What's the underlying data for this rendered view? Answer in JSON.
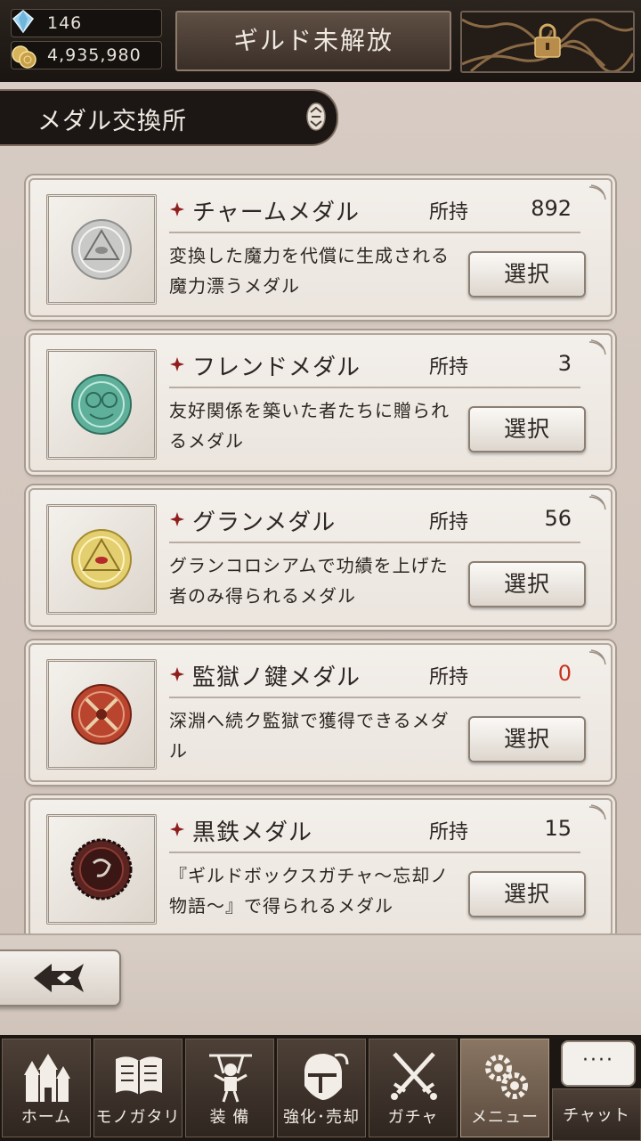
{
  "header": {
    "gems": "146",
    "coins": "4,935,980",
    "guild_label": "ギルド未解放",
    "locked_icon": "padlock-chains-icon"
  },
  "page": {
    "title": "メダル交換所"
  },
  "medals": [
    {
      "name": "チャームメダル",
      "own_label": "所持",
      "own_value": "892",
      "desc": "変換した魔力を代償に生成される魔力漂うメダル",
      "button": "選択",
      "color": "#c9c9c7",
      "icon": "charm-medal-icon"
    },
    {
      "name": "フレンドメダル",
      "own_label": "所持",
      "own_value": "3",
      "desc": "友好関係を築いた者たちに贈られるメダル",
      "button": "選択",
      "color": "#5fb09a",
      "icon": "friend-medal-icon"
    },
    {
      "name": "グランメダル",
      "own_label": "所持",
      "own_value": "56",
      "desc": "グランコロシアムで功績を上げた者のみ得られるメダル",
      "button": "選択",
      "color": "#e3cf70",
      "icon": "gran-medal-icon"
    },
    {
      "name": "監獄ノ鍵メダル",
      "own_label": "所持",
      "own_value": "0",
      "desc": "深淵へ続ク監獄で獲得できるメダル",
      "button": "選択",
      "color": "#b9452e",
      "icon": "prison-key-medal-icon"
    },
    {
      "name": "黒鉄メダル",
      "own_label": "所持",
      "own_value": "15",
      "desc": "『ギルドボックスガチャ～忘却ノ物語～』で得られるメダル",
      "button": "選択",
      "color": "#5a2421",
      "icon": "black-iron-medal-icon"
    }
  ],
  "back": {
    "icon": "back-arrow-icon"
  },
  "nav": {
    "home": "ホーム",
    "story": "モノガタリ",
    "equip": "装 備",
    "enhance": "強化･売却",
    "gacha": "ガチャ",
    "menu": "メニュー",
    "chat": "チャット",
    "chat_dots": "····"
  }
}
